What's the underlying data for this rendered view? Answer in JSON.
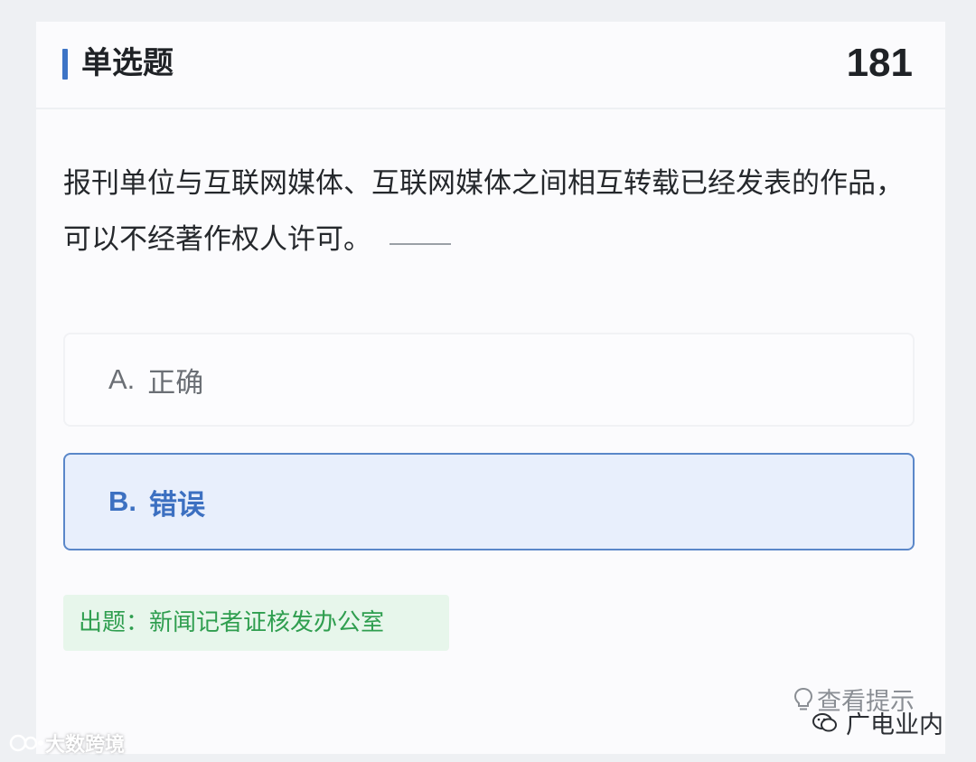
{
  "header": {
    "title": "单选题",
    "number": "181"
  },
  "question": {
    "text": "报刊单位与互联网媒体、互联网媒体之间相互转载已经发表的作品，可以不经著作权人许可。"
  },
  "options": [
    {
      "letter": "A.",
      "label": "正确",
      "selected": false
    },
    {
      "letter": "B.",
      "label": "错误",
      "selected": true
    }
  ],
  "source": {
    "text": "出题：新闻记者证核发办公室"
  },
  "hint": {
    "label": "查看提示",
    "icon": "lightbulb-icon"
  },
  "watermarks": {
    "left": "大数跨境",
    "right": "广电业内"
  },
  "colors": {
    "accent": "#3d74c6",
    "selected_bg": "#e8effc",
    "source_green": "#2f9e4f",
    "source_bg": "#e7f6eb"
  }
}
